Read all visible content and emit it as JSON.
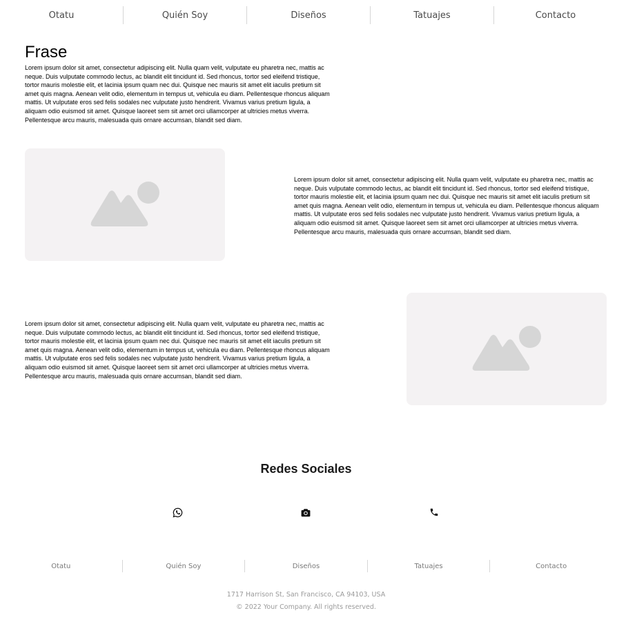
{
  "nav": {
    "items": [
      {
        "label": "Otatu"
      },
      {
        "label": "Quién Soy"
      },
      {
        "label": "Diseños"
      },
      {
        "label": "Tatuajes"
      },
      {
        "label": "Contacto"
      }
    ]
  },
  "main": {
    "title": "Frase",
    "paragraphs": [
      "Lorem ipsum dolor sit amet, consectetur adipiscing elit. Nulla quam velit, vulputate eu pharetra nec, mattis ac neque. Duis vulputate commodo lectus, ac blandit elit tincidunt id. Sed rhoncus, tortor sed eleifend tristique, tortor mauris molestie elit, et lacinia ipsum quam nec dui. Quisque nec mauris sit amet elit iaculis pretium sit amet quis magna. Aenean velit odio, elementum in tempus ut, vehicula eu diam. Pellentesque rhoncus aliquam mattis. Ut vulputate eros sed felis sodales nec vulputate justo hendrerit. Vivamus varius pretium ligula, a aliquam odio euismod sit amet. Quisque laoreet sem sit amet orci ullamcorper at ultricies metus viverra. Pellentesque arcu mauris, malesuada quis ornare accumsan, blandit sed diam.",
      "Lorem ipsum dolor sit amet, consectetur adipiscing elit. Nulla quam velit, vulputate eu pharetra nec, mattis ac neque. Duis vulputate commodo lectus, ac blandit elit tincidunt id. Sed rhoncus, tortor sed eleifend tristique, tortor mauris molestie elit, et lacinia ipsum quam nec dui. Quisque nec mauris sit amet elit iaculis pretium sit amet quis magna. Aenean velit odio, elementum in tempus ut, vehicula eu diam. Pellentesque rhoncus aliquam mattis. Ut vulputate eros sed felis sodales nec vulputate justo hendrerit. Vivamus varius pretium ligula, a aliquam odio euismod sit amet. Quisque laoreet sem sit amet orci ullamcorper at ultricies metus viverra. Pellentesque arcu mauris, malesuada quis ornare accumsan, blandit sed diam.",
      "Lorem ipsum dolor sit amet, consectetur adipiscing elit. Nulla quam velit, vulputate eu pharetra nec, mattis ac neque. Duis vulputate commodo lectus, ac blandit elit tincidunt id. Sed rhoncus, tortor sed eleifend tristique, tortor mauris molestie elit, et lacinia ipsum quam nec dui. Quisque nec mauris sit amet elit iaculis pretium sit amet quis magna. Aenean velit odio, elementum in tempus ut, vehicula eu diam. Pellentesque rhoncus aliquam mattis. Ut vulputate eros sed felis sodales nec vulputate justo hendrerit. Vivamus varius pretium ligula, a aliquam odio euismod sit amet. Quisque laoreet sem sit amet orci ullamcorper at ultricies metus viverra. Pellentesque arcu mauris, malesuada quis ornare accumsan, blandit sed diam."
    ],
    "image_icon": "image-placeholder-icon"
  },
  "social": {
    "title": "Redes Sociales",
    "icons": [
      "whatsapp-icon",
      "camera-icon",
      "phone-icon"
    ]
  },
  "footer": {
    "nav": [
      {
        "label": "Otatu"
      },
      {
        "label": "Quién Soy"
      },
      {
        "label": "Diseños"
      },
      {
        "label": "Tatuajes"
      },
      {
        "label": "Contacto"
      }
    ],
    "address": "1717 Harrison St, San Francisco, CA 94103, USA",
    "copyright": "© 2022 Your Company.  All rights reserved."
  },
  "colors": {
    "placeholder_bg": "#f4f2f3",
    "placeholder_icon": "#d6d6d6",
    "nav_text": "#4a4a4a",
    "footer_text": "#9a9a9a"
  }
}
